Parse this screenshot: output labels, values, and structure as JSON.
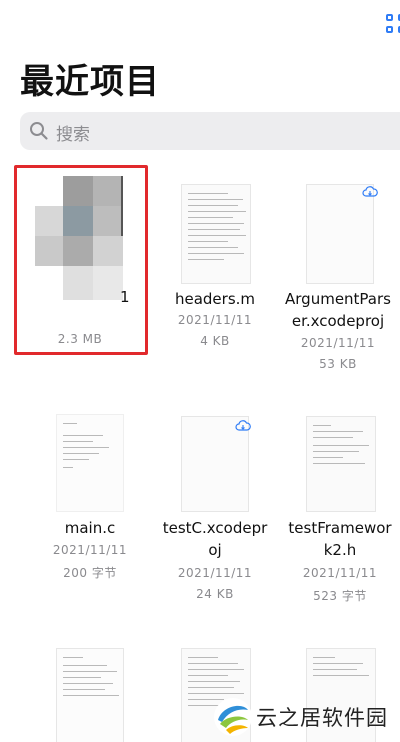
{
  "header": {
    "title": "最近项目",
    "view_toggle_icon": "grid-icon"
  },
  "search": {
    "placeholder": "搜索",
    "icon": "search-icon"
  },
  "files": [
    {
      "name": "",
      "date": "",
      "size": "2.3 MB",
      "selected": true
    },
    {
      "name": "headers.m",
      "date": "2021/11/11",
      "size": "4 KB"
    },
    {
      "name": "ArgumentParser.xcodeproj",
      "name_line1": "ArgumentPars",
      "name_line2": "er.xcodeproj",
      "date": "2021/11/11",
      "size": "53 KB",
      "cloud": true
    },
    {
      "name": "main.c",
      "date": "2021/11/11",
      "size": "200 字节"
    },
    {
      "name": "testC.xcodeproj",
      "name_line1": "testC.xcodepr",
      "name_line2": "oj",
      "date": "2021/11/11",
      "size": "24 KB",
      "cloud": true
    },
    {
      "name": "testFramework2.h",
      "name_line1": "testFramewor",
      "name_line2": "k2.h",
      "date": "2021/11/11",
      "size": "523 字节"
    }
  ],
  "partial_name_char": "1",
  "watermark": {
    "text": "云之居软件园"
  },
  "colors": {
    "accent": "#2f7cf6",
    "selection": "#e1292c"
  }
}
